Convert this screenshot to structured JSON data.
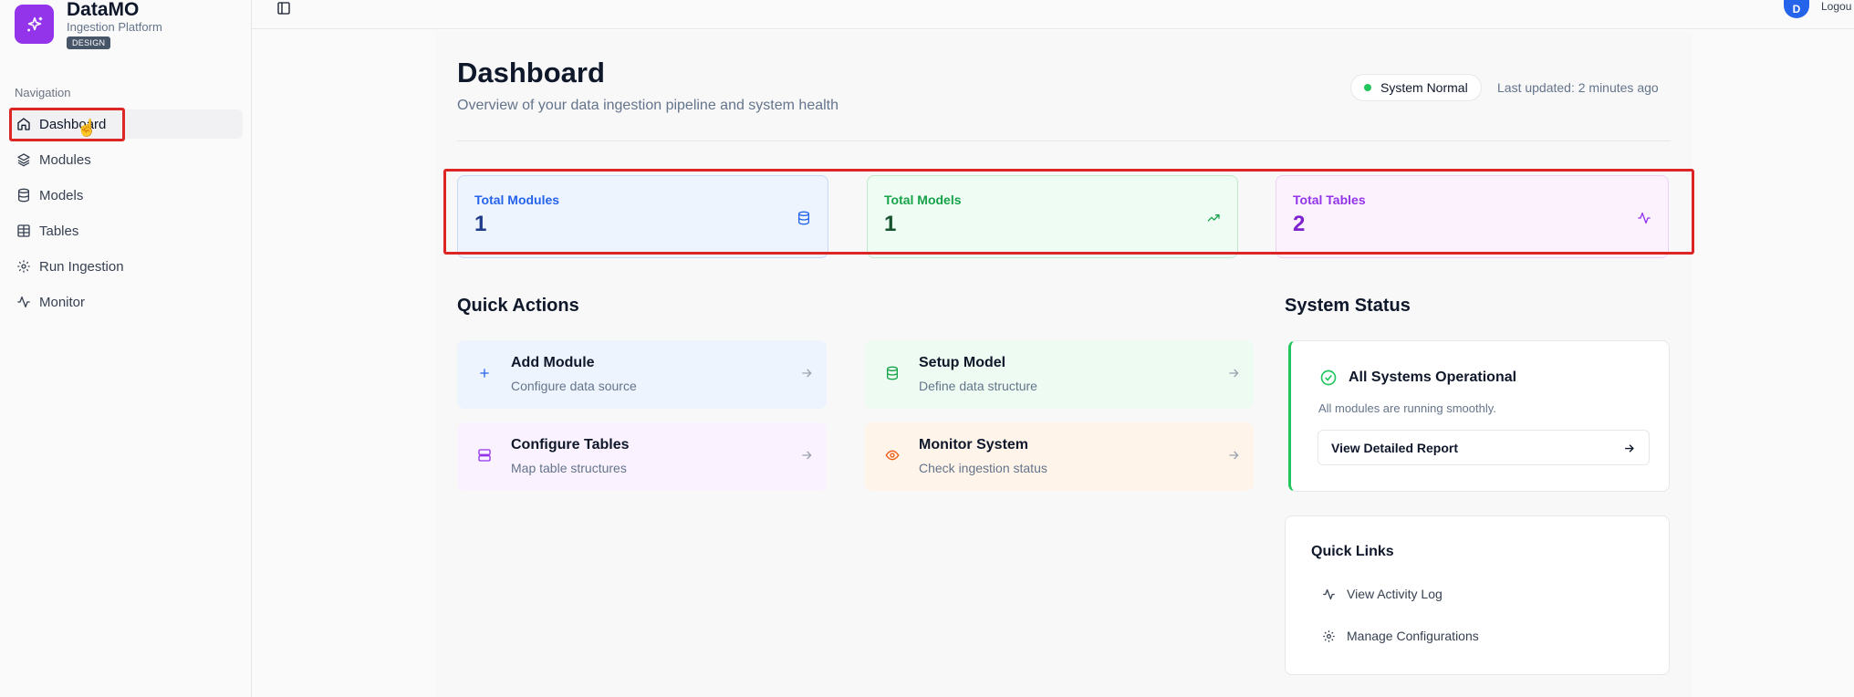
{
  "brand": {
    "title": "DataMO",
    "subtitle": "Ingestion Platform",
    "badge": "DESIGN"
  },
  "sidebar": {
    "section_label": "Navigation",
    "items": [
      {
        "label": "Dashboard",
        "icon": "home-icon",
        "active": true
      },
      {
        "label": "Modules",
        "icon": "layers-icon"
      },
      {
        "label": "Models",
        "icon": "database-icon"
      },
      {
        "label": "Tables",
        "icon": "table-icon"
      },
      {
        "label": "Run Ingestion",
        "icon": "gear-icon"
      },
      {
        "label": "Monitor",
        "icon": "activity-icon"
      }
    ]
  },
  "topbar": {
    "avatar_initial": "D",
    "logout_label": "Logou"
  },
  "header": {
    "title": "Dashboard",
    "subtitle": "Overview of your data ingestion pipeline and system health",
    "status": "System Normal",
    "last_updated": "Last updated: 2 minutes ago"
  },
  "stats": [
    {
      "label": "Total Modules",
      "value": "1",
      "icon": "database-icon",
      "color": "#2563eb"
    },
    {
      "label": "Total Models",
      "value": "1",
      "icon": "trending-up-icon",
      "color": "#16a34a"
    },
    {
      "label": "Total Tables",
      "value": "2",
      "icon": "activity-icon",
      "color": "#9333ea"
    }
  ],
  "quick_actions": {
    "title": "Quick Actions",
    "items": [
      {
        "title": "Add Module",
        "desc": "Configure data source",
        "icon": "plus-icon"
      },
      {
        "title": "Setup Model",
        "desc": "Define data structure",
        "icon": "database-icon"
      },
      {
        "title": "Configure Tables",
        "desc": "Map table structures",
        "icon": "server-icon"
      },
      {
        "title": "Monitor System",
        "desc": "Check ingestion status",
        "icon": "eye-icon"
      }
    ]
  },
  "system_status": {
    "title": "System Status",
    "card_title": "All Systems Operational",
    "card_desc": "All modules are running smoothly.",
    "button_label": "View Detailed Report"
  },
  "quick_links": {
    "title": "Quick Links",
    "items": [
      {
        "label": "View Activity Log",
        "icon": "activity-icon"
      },
      {
        "label": "Manage Configurations",
        "icon": "gear-icon"
      }
    ]
  },
  "colors": {
    "accent_purple": "#9333ea",
    "highlight_red": "#dc2626",
    "status_green": "#22c55e"
  }
}
